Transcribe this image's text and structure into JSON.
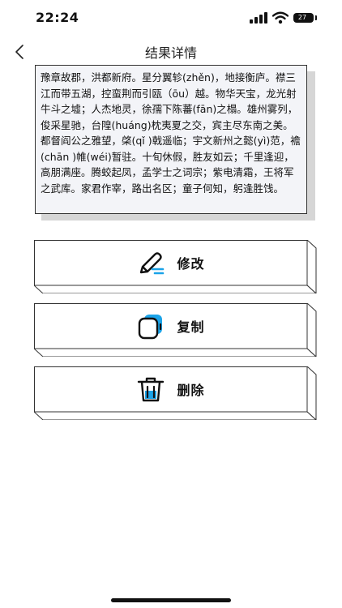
{
  "status_bar": {
    "time": "22:24",
    "battery_level": "27"
  },
  "nav": {
    "title": "结果详情"
  },
  "result": {
    "text": "豫章故郡，洪都新府。星分翼轸(zhěn)，地接衡庐。襟三江而带五湖，控蛮荆而引瓯（ōu）越。物华天宝，龙光射牛斗之墟；人杰地灵，徐孺下陈蕃(fān)之榻。雄州雾列，俊采星驰，台隍(huáng)枕夷夏之交，宾主尽东南之美。都督阎公之雅望，棨(qǐ )戟遥临；宇文新州之懿(yì)范，襜(chān )帷(wéi)暂驻。十旬休假，胜友如云；千里逢迎，高朋满座。腾蛟起凤，孟学士之词宗；紫电清霜，王将军之武库。家君作宰，路出名区；童子何知，躬逢胜饯。"
  },
  "actions": {
    "edit_label": "修改",
    "copy_label": "复制",
    "delete_label": "删除"
  },
  "icons": {
    "back": "chevron-left-icon",
    "edit": "pen-icon",
    "copy": "copy-icon",
    "delete": "trash-icon"
  },
  "colors": {
    "accent": "#1ba3e8",
    "card_bg": "#f3f4f8"
  }
}
